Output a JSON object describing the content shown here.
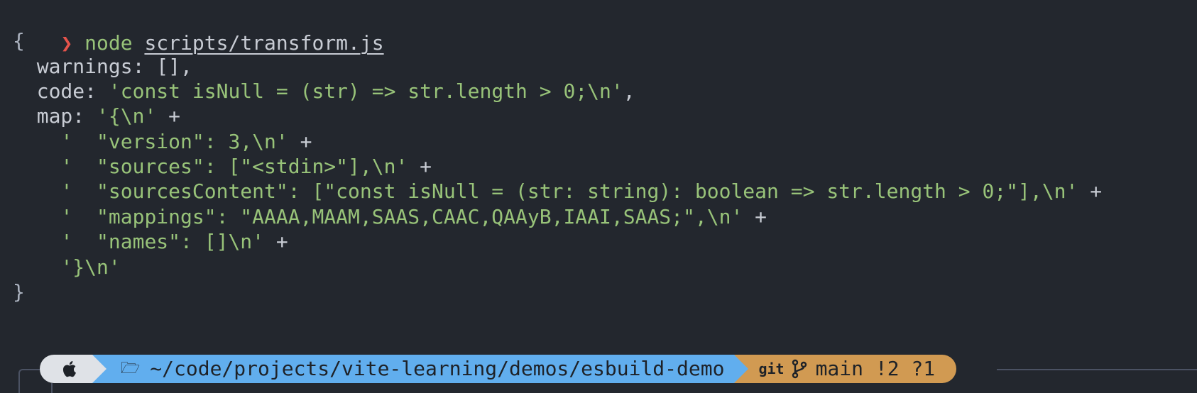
{
  "prompt": {
    "arrow": "❯",
    "command": "node",
    "argument": "scripts/transform.js"
  },
  "output": {
    "open_brace": "{",
    "warnings_key": "warnings",
    "warnings_value": "[],",
    "code_key": "code",
    "code_value": "'const isNull = (str) => str.length > 0;\\n'",
    "map_key": "map",
    "map_first": "'{\\n'",
    "map_lines": [
      "'  \"version\": 3,\\n'",
      "'  \"sources\": [\"<stdin>\"],\\n'",
      "'  \"sourcesContent\": [\"const isNull = (str: string): boolean => str.length > 0;\"],\\n'",
      "'  \"mappings\": \"AAAA,MAAM,SAAS,CAAC,QAAyB,IAAI,SAAS;\",\\n'",
      "'  \"names\": []\\n'"
    ],
    "map_last": "'}\\n'",
    "concat_op": "+",
    "close_brace": "}"
  },
  "statusbar": {
    "os_icon": "apple-icon",
    "folder_icon": "folder-icon",
    "path": "~/code/projects/vite-learning/demos/esbuild-demo",
    "git_label": "git",
    "branch_icon": "branch-icon",
    "branch": "main",
    "status": "!2 ?1",
    "colors": {
      "os_bg": "#dfe2e7",
      "path_bg": "#61aeee",
      "git_bg": "#d19a52"
    }
  }
}
